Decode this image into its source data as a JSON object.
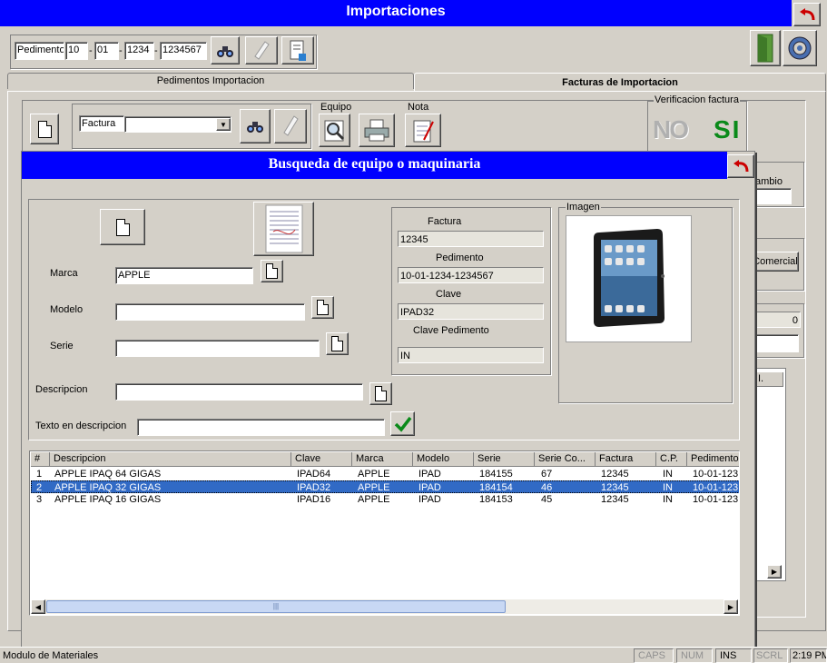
{
  "main_title": "Importaciones",
  "pedimento": {
    "label": "Pedimento",
    "parts": [
      "10",
      "01",
      "1234",
      "1234567"
    ],
    "sep": "-"
  },
  "tabs": [
    "Pedimentos Importacion",
    "Facturas de Importacion"
  ],
  "factura": {
    "label": "Factura",
    "value": ""
  },
  "equipo_label": "Equipo",
  "nota_label": "Nota",
  "verificacion": {
    "label": "Verificacion factura",
    "no": "NO",
    "si": "SI"
  },
  "right_panel": {
    "cambio": "ambio",
    "comercial": "Comercial",
    "zero": "0",
    "col": "I."
  },
  "dialog": {
    "title": "Busqueda de equipo o maquinaria",
    "marca": {
      "label": "Marca",
      "value": "APPLE"
    },
    "modelo": {
      "label": "Modelo",
      "value": ""
    },
    "serie": {
      "label": "Serie",
      "value": ""
    },
    "descripcion": {
      "label": "Descripcion",
      "value": ""
    },
    "texto": {
      "label": "Texto en descripcion",
      "value": ""
    },
    "info": {
      "factura_label": "Factura",
      "factura": "12345",
      "pedimento_label": "Pedimento",
      "pedimento": "10-01-1234-1234567",
      "clave_label": "Clave",
      "clave": "IPAD32",
      "clave_ped_label": "Clave Pedimento",
      "clave_ped": "IN"
    },
    "imagen_label": "Imagen",
    "table": {
      "headers": [
        "#",
        "Descripcion",
        "Clave",
        "Marca",
        "Modelo",
        "Serie",
        "Serie Co...",
        "Factura",
        "C.P.",
        "Pedimento"
      ],
      "rows": [
        [
          "1",
          "APPLE IPAQ 64 GIGAS",
          "IPAD64",
          "APPLE",
          "IPAD",
          "184155",
          "67",
          "12345",
          "IN",
          "10-01-123"
        ],
        [
          "2",
          "APPLE IPAQ 32 GIGAS",
          "IPAD32",
          "APPLE",
          "IPAD",
          "184154",
          "46",
          "12345",
          "IN",
          "10-01-123"
        ],
        [
          "3",
          "APPLE IPAQ 16 GIGAS",
          "IPAD16",
          "APPLE",
          "IPAD",
          "184153",
          "45",
          "12345",
          "IN",
          "10-01-123"
        ]
      ],
      "selected_row": 1
    }
  },
  "status": {
    "left": "Modulo de Materiales",
    "caps": "CAPS",
    "num": "NUM",
    "ins": "INS",
    "scrl": "SCRL",
    "time": "2:19 PM"
  },
  "colors": {
    "title_bar": "#0000ff",
    "selection": "#316ac5",
    "face": "#d4d0c8"
  }
}
